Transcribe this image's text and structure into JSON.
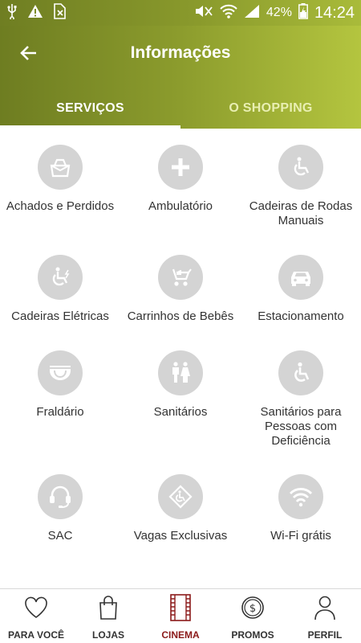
{
  "statusbar": {
    "battery": "42%",
    "time": "14:24"
  },
  "header": {
    "title": "Informações"
  },
  "tabs": [
    {
      "label": "SERVIÇOS"
    },
    {
      "label": "O SHOPPING"
    }
  ],
  "services": [
    {
      "label": "Achados e Perdidos",
      "icon": "bag-icon"
    },
    {
      "label": "Ambulatório",
      "icon": "plus-icon"
    },
    {
      "label": "Cadeiras de Rodas Manuais",
      "icon": "wheelchair-icon"
    },
    {
      "label": "Cadeiras Elétricas",
      "icon": "electric-wheelchair-icon"
    },
    {
      "label": "Carrinhos de Bebês",
      "icon": "stroller-icon"
    },
    {
      "label": "Estacionamento",
      "icon": "car-icon"
    },
    {
      "label": "Fraldário",
      "icon": "diaper-icon"
    },
    {
      "label": "Sanitários",
      "icon": "restroom-icon"
    },
    {
      "label": "Sanitários para Pessoas com Deficiência",
      "icon": "accessible-icon"
    },
    {
      "label": "SAC",
      "icon": "headset-icon"
    },
    {
      "label": "Vagas Exclusivas",
      "icon": "accessible-parking-icon"
    },
    {
      "label": "Wi-Fi grátis",
      "icon": "wifi-icon"
    }
  ],
  "bottom_nav": [
    {
      "label": "PARA VOCÊ",
      "icon": "heart-icon"
    },
    {
      "label": "LOJAS",
      "icon": "shopping-bag-icon"
    },
    {
      "label": "CINEMA",
      "icon": "film-icon",
      "active": true
    },
    {
      "label": "PROMOS",
      "icon": "coin-icon"
    },
    {
      "label": "PERFIL",
      "icon": "person-icon"
    }
  ],
  "colors": {
    "header_start": "#6e7d21",
    "header_end": "#b4c53f",
    "icon_circle": "#d4d4d4",
    "active_nav": "#8b1a1a"
  }
}
